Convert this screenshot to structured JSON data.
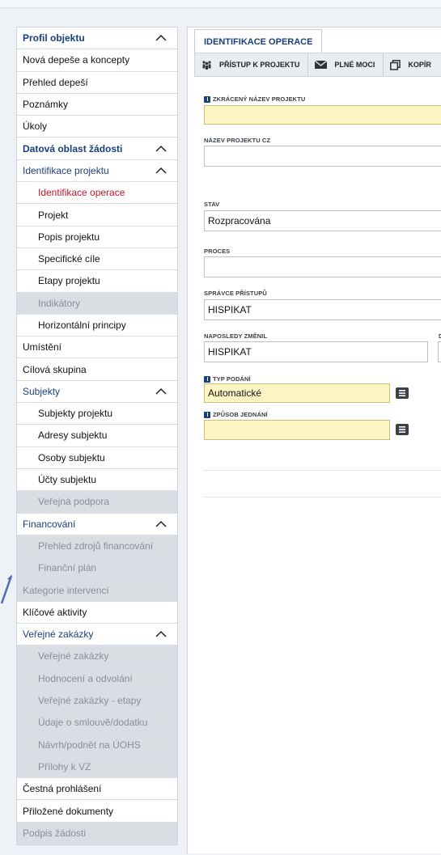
{
  "sidebar": {
    "items": [
      {
        "label": "Profil objektu",
        "kind": "section",
        "chevron": true
      },
      {
        "label": "Nová depeše a koncepty",
        "kind": "item"
      },
      {
        "label": "Přehled depeší",
        "kind": "item"
      },
      {
        "label": "Poznámky",
        "kind": "item"
      },
      {
        "label": "Úkoly",
        "kind": "item"
      },
      {
        "label": "Datová oblast žádosti",
        "kind": "section",
        "chevron": true
      },
      {
        "label": "Identifikace projektu",
        "kind": "section-normal",
        "chevron": true
      },
      {
        "label": "Identifikace operace",
        "kind": "sub-active"
      },
      {
        "label": "Projekt",
        "kind": "sub"
      },
      {
        "label": "Popis projektu",
        "kind": "sub"
      },
      {
        "label": "Specifické cíle",
        "kind": "sub"
      },
      {
        "label": "Etapy projektu",
        "kind": "sub"
      },
      {
        "label": "Indikátory",
        "kind": "sub-disabled"
      },
      {
        "label": "Horizontální principy",
        "kind": "sub"
      },
      {
        "label": "Umístění",
        "kind": "item"
      },
      {
        "label": "Cílová skupina",
        "kind": "item"
      },
      {
        "label": "Subjekty",
        "kind": "section-normal",
        "chevron": true
      },
      {
        "label": "Subjekty projektu",
        "kind": "sub"
      },
      {
        "label": "Adresy subjektu",
        "kind": "sub"
      },
      {
        "label": "Osoby subjektu",
        "kind": "sub"
      },
      {
        "label": "Účty subjektu",
        "kind": "sub"
      },
      {
        "label": "Veřejná podpora",
        "kind": "sub-disabled"
      },
      {
        "label": "Financování",
        "kind": "section-normal",
        "chevron": true
      },
      {
        "label": "Přehled zdrojů financování",
        "kind": "sub-disabled"
      },
      {
        "label": "Finanční plán",
        "kind": "sub-disabled"
      },
      {
        "label": "Kategorie intervencí",
        "kind": "item-disabled"
      },
      {
        "label": "Klíčové aktivity",
        "kind": "item"
      },
      {
        "label": "Veřejné zakázky",
        "kind": "section-normal",
        "chevron": true
      },
      {
        "label": "Veřejné zakázky",
        "kind": "sub-disabled"
      },
      {
        "label": "Hodnocení a odvolání",
        "kind": "sub-disabled"
      },
      {
        "label": "Veřejné zakázky - etapy",
        "kind": "sub-disabled"
      },
      {
        "label": "Údaje o smlouvě/dodatku",
        "kind": "sub-disabled"
      },
      {
        "label": "Návrh/podnět na ÚOHS",
        "kind": "sub-disabled"
      },
      {
        "label": "Přílohy k VZ",
        "kind": "sub-disabled"
      },
      {
        "label": "Čestná prohlášení",
        "kind": "item"
      },
      {
        "label": "Přiložené dokumenty",
        "kind": "item"
      },
      {
        "label": "Podpis žádosti",
        "kind": "item-disabled"
      }
    ]
  },
  "main": {
    "tab_title": "IDENTIFIKACE OPERACE",
    "subtabs": [
      {
        "label": "PŘÍSTUP K PROJEKTU",
        "icon": "people-icon"
      },
      {
        "label": "PLNÉ MOCI",
        "icon": "envelope-icon"
      },
      {
        "label": "KOPÍR",
        "icon": "copy-icon"
      }
    ]
  },
  "form": {
    "short_name": {
      "label": "ZKRÁCENÝ NÁZEV PROJEKTU",
      "value": "",
      "required": true
    },
    "name_cz": {
      "label": "NÁZEV PROJEKTU CZ",
      "value": ""
    },
    "state": {
      "label": "STAV",
      "value": "Rozpracována"
    },
    "process": {
      "label": "PROCES",
      "value": ""
    },
    "access_admin": {
      "label": "SPRÁVCE PŘÍSTUPŮ",
      "value": "HISPIKAT"
    },
    "last_changed": {
      "label": "NAPOSLEDY ZMĚNIL",
      "value": "HISPIKAT",
      "extra_label": "D"
    },
    "submit_type": {
      "label": "TYP PODÁNÍ",
      "value": "Automatické",
      "required": true
    },
    "negotiation": {
      "label": "ZPŮSOB JEDNÁNÍ",
      "value": "",
      "required": true
    }
  },
  "colors": {
    "accent": "#1a3f7a",
    "active": "#c0182c",
    "disabled_bg": "#dadde1",
    "required_field": "#fdf6c4"
  }
}
